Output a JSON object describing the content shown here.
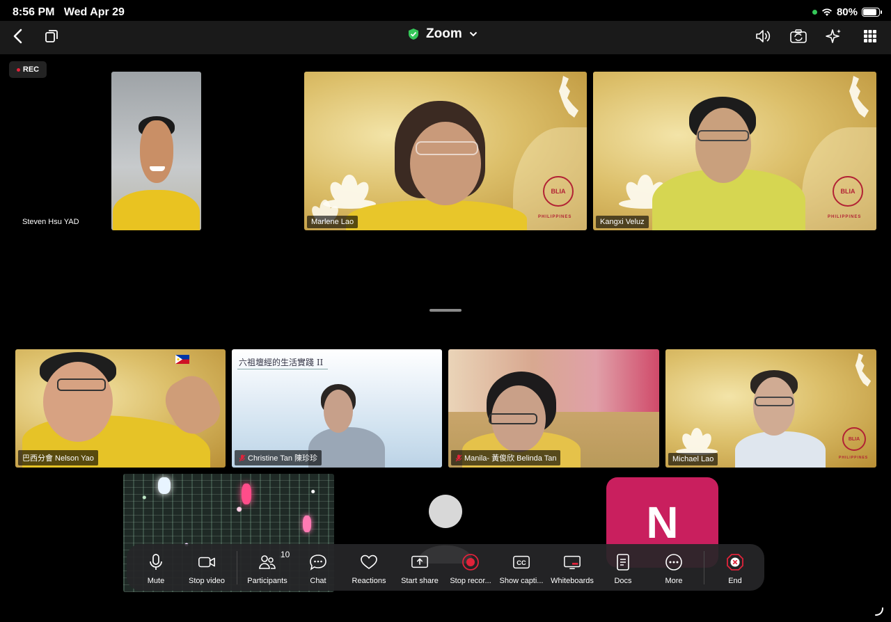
{
  "status_bar": {
    "time": "8:56 PM",
    "date": "Wed Apr 29",
    "battery": "80%",
    "battery_level": 0.8
  },
  "top_bar": {
    "title": "Zoom"
  },
  "recording": {
    "label": "REC"
  },
  "participants": [
    {
      "name": "Steven Hsu YAD"
    },
    {
      "name": "Marlene Lao"
    },
    {
      "name": "Kangxi Veluz"
    },
    {
      "name": "巴西分會 Nelson Yao"
    },
    {
      "name": "Christine Tan 陳珍珍",
      "muted": true
    },
    {
      "name": "Manila- 黃俊欣 Belinda Tan",
      "muted": true
    },
    {
      "name": "Michael Lao"
    }
  ],
  "slide": {
    "title": "六祖壇經的生活實踐 II"
  },
  "n_tile": {
    "initial": "N"
  },
  "controls": {
    "mute": "Mute",
    "stop_video": "Stop video",
    "participants": "Participants",
    "participants_count": "10",
    "chat": "Chat",
    "reactions": "Reactions",
    "start_share": "Start share",
    "stop_recording": "Stop recor...",
    "show_captions": "Show capti...",
    "whiteboards": "Whiteboards",
    "docs": "Docs",
    "more": "More",
    "end": "End"
  },
  "colors": {
    "accent_green": "#35c759",
    "record_red": "#e0233a",
    "end_red": "#e0233a",
    "n_tile": "#c91f5e"
  }
}
